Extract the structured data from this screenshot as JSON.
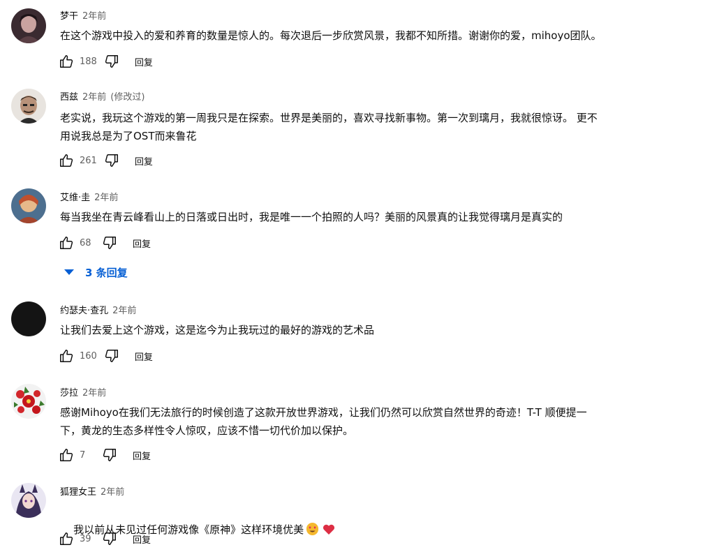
{
  "comments": [
    {
      "author": "梦干",
      "time": "2年前",
      "edited": "",
      "text": "在这个游戏中投入的爱和养育的数量是惊人的。每次退后一步欣赏风景，我都不知所措。谢谢你的爱，mihoyo团队。",
      "likes": "188",
      "reply_label": "回复"
    },
    {
      "author": "西兹",
      "time": "2年前",
      "edited": "(修改过)",
      "text": "老实说，我玩这个游戏的第一周我只是在探索。世界是美丽的，喜欢寻找新事物。第一次到璃月，我就很惊讶。 更不\n用说我总是为了OST而来鲁花",
      "likes": "261",
      "reply_label": "回复"
    },
    {
      "author": "艾维·圭",
      "time": "2年前",
      "edited": "",
      "text": "每当我坐在青云峰看山上的日落或日出时，我是唯一一个拍照的人吗？美丽的风景真的让我觉得璃月是真实的",
      "likes": "68",
      "reply_label": "回复",
      "replies_label": "3 条回复"
    },
    {
      "author": "约瑟夫·查孔",
      "time": "2年前",
      "edited": "",
      "text": "让我们去爱上这个游戏，这是迄今为止我玩过的最好的游戏的艺术品",
      "likes": "160",
      "reply_label": "回复"
    },
    {
      "author": "莎拉",
      "time": "2年前",
      "edited": "",
      "text": "感谢Mihoyo在我们无法旅行的时候创造了这款开放世界游戏，让我们仍然可以欣赏自然世界的奇迹！T-T 顺便提一\n下，黄龙的生态多样性令人惊叹，应该不惜一切代价加以保护。",
      "likes": "7",
      "reply_label": "回复"
    },
    {
      "author": "狐狸女王",
      "time": "2年前",
      "edited": "",
      "text": "我以前从未见过任何游戏像《原神》这样环境优美",
      "likes": "39",
      "reply_label": "回复",
      "emojis": [
        "smiling-face-with-heart-eyes",
        "red-heart"
      ]
    }
  ],
  "colors": {
    "link_blue": "#065fd4",
    "secondary_text": "#606060",
    "primary_text": "#0f0f0f"
  }
}
